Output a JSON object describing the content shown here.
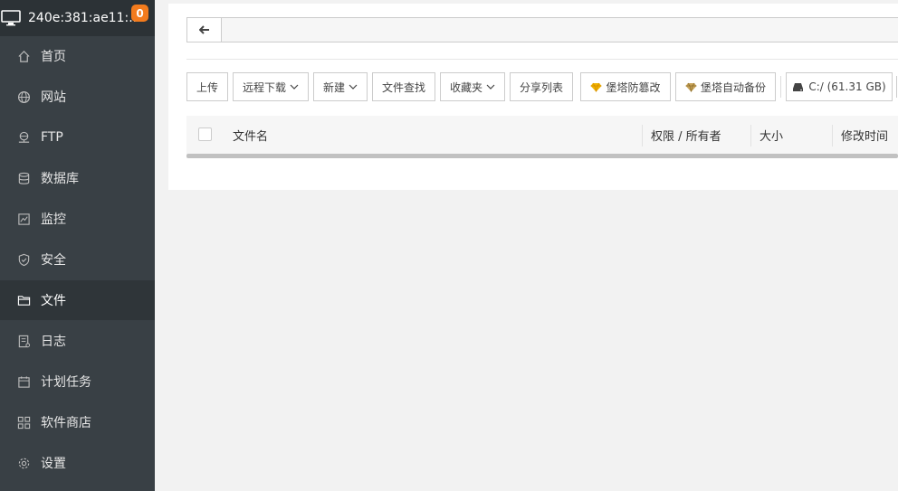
{
  "sidebar": {
    "host": "240e:381:ae11:...",
    "badge": "0",
    "items": [
      {
        "label": "首页",
        "icon": "home-icon"
      },
      {
        "label": "网站",
        "icon": "globe-icon"
      },
      {
        "label": "FTP",
        "icon": "ftp-icon"
      },
      {
        "label": "数据库",
        "icon": "database-icon"
      },
      {
        "label": "监控",
        "icon": "monitor-icon"
      },
      {
        "label": "安全",
        "icon": "shield-icon"
      },
      {
        "label": "文件",
        "icon": "folder-icon",
        "active": true
      },
      {
        "label": "日志",
        "icon": "log-icon"
      },
      {
        "label": "计划任务",
        "icon": "calendar-icon"
      },
      {
        "label": "软件商店",
        "icon": "apps-icon"
      },
      {
        "label": "设置",
        "icon": "gear-icon"
      }
    ]
  },
  "toolbar": {
    "upload": "上传",
    "remote_download": "远程下载",
    "new": "新建",
    "file_search": "文件查找",
    "favorites": "收藏夹",
    "share_list": "分享列表",
    "tamper_proof": "堡塔防篡改",
    "auto_backup": "堡塔自动备份",
    "drive": "C:/ (61.31 GB)"
  },
  "table": {
    "columns": [
      "文件名",
      "权限 / 所有者",
      "大小",
      "修改时间"
    ]
  },
  "colors": {
    "sidebar_bg": "#394045",
    "badge": "#f37b1d",
    "gem": "#f0b400"
  }
}
